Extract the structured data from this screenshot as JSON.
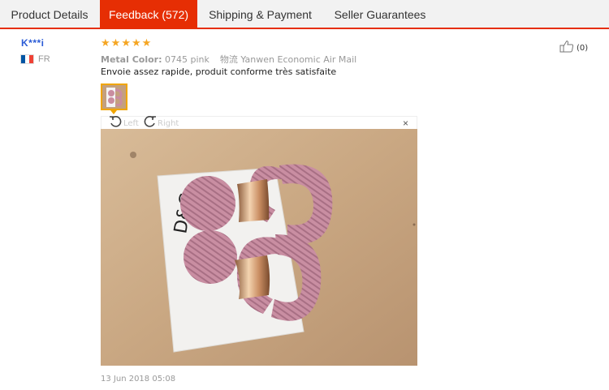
{
  "tabs": [
    {
      "label": "Product Details"
    },
    {
      "label": "Feedback (572)"
    },
    {
      "label": "Shipping & Payment"
    },
    {
      "label": "Seller Guarantees"
    }
  ],
  "active_tab": 1,
  "buyer": {
    "name": "K***i",
    "country": "FR",
    "flag_colors": [
      "#0055a4",
      "#ffffff",
      "#ef4135"
    ]
  },
  "feedback": {
    "rating": 5,
    "star_color": "#f5a623",
    "attribute_label": "Metal Color:",
    "attribute_value": "0745 pink",
    "shipping": "物流 Yanwen Economic Air Mail",
    "text": "Envoie assez rapide, produit conforme très satisfaite",
    "like_count": "(0)",
    "date": "13 Jun 2018 05:08"
  },
  "viewer": {
    "rotate_left_label": "Left",
    "rotate_right_label": "Right",
    "close_symbol": "×"
  },
  "icons": {
    "like": "thumbs-up-icon",
    "rotate_left": "rotate-left-icon",
    "rotate_right": "rotate-right-icon",
    "close": "close-icon"
  },
  "colors": {
    "accent": "#e62e04",
    "link": "#2a5bd6",
    "thumbnail_border": "#f0a500"
  }
}
